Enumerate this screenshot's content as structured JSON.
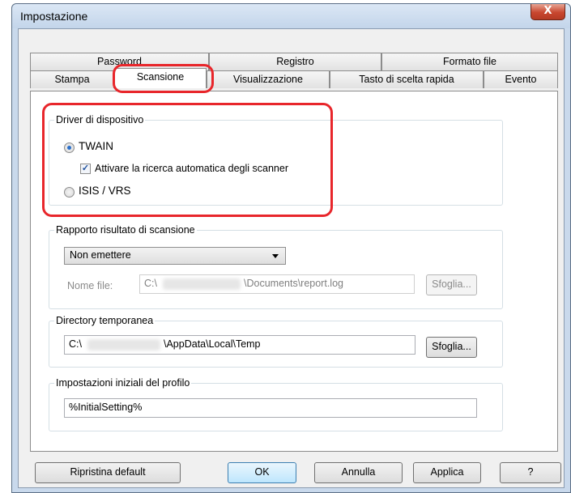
{
  "window": {
    "title": "Impostazione",
    "close_glyph": "X"
  },
  "tabs": {
    "row_back": [
      "Password",
      "Registro",
      "Formato file"
    ],
    "row_front": [
      "Stampa",
      "Scansione",
      "Visualizzazione",
      "Tasto di scelta rapida",
      "Evento"
    ],
    "active": "Scansione"
  },
  "driver": {
    "legend": "Driver di dispositivo",
    "twain_label": "TWAIN",
    "twain_selected": true,
    "auto_search_label": "Attivare la ricerca automatica degli scanner",
    "auto_search_checked": true,
    "isis_label": "ISIS / VRS",
    "isis_selected": false
  },
  "report": {
    "legend": "Rapporto risultato di scansione",
    "select_value": "Non emettere",
    "file_label": "Nome file:",
    "file_prefix": "C:\\",
    "file_suffix": "\\Documents\\report.log",
    "browse_label": "Sfoglia..."
  },
  "tempdir": {
    "legend": "Directory temporanea",
    "path_prefix": "C:\\",
    "path_suffix": "\\AppData\\Local\\Temp",
    "browse_label": "Sfoglia..."
  },
  "profile": {
    "legend": "Impostazioni iniziali del profilo",
    "value": "%InitialSetting%"
  },
  "buttons": {
    "reset": "Ripristina default",
    "ok": "OK",
    "cancel": "Annulla",
    "apply": "Applica",
    "help": "?"
  },
  "colors": {
    "highlight": "#e8262b",
    "close_button": "#c8472f"
  }
}
